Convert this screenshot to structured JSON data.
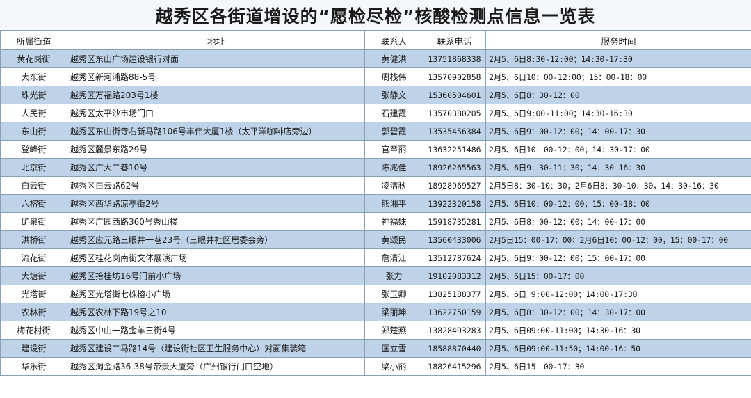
{
  "title": "越秀区各街道增设的“愿检尽检”核酸检测点信息一览表",
  "headers": {
    "street": "所属街道",
    "address": "地址",
    "contact": "联系人",
    "phone": "联系电话",
    "hours": "服务时间"
  },
  "rows": [
    {
      "street": "黄花岗街",
      "address": "越秀区东山广场建设银行对面",
      "contact": "黄健洪",
      "phone": "13751868338",
      "hours": "2月5、6日8:30-12:00；14:30-17:30"
    },
    {
      "street": "大东街",
      "address": "越秀区新河浦路88-5号",
      "contact": "周栈伟",
      "phone": "13570902858",
      "hours": "2月5、6日10：00-12:00；15：00-18：00"
    },
    {
      "street": "珠光街",
      "address": "越秀区万福路203号1楼",
      "contact": "张静文",
      "phone": "15360504601",
      "hours": "2月5、6日8：30-12：00"
    },
    {
      "street": "人民街",
      "address": "越秀区太平沙市场门口",
      "contact": "石建霞",
      "phone": "13570380205",
      "hours": "2月5、6日9:00-11:00；14:30-16:30"
    },
    {
      "street": "东山街",
      "address": "越秀区东山街寺右新马路106号丰伟大厦1楼（太平洋咖啡店旁边）",
      "contact": "郭碧霞",
      "phone": "13535456384",
      "hours": "2月5、6日9：00-12：00；14：00-17：30"
    },
    {
      "street": "登峰街",
      "address": "越秀区麓景东路29号",
      "contact": "官章丽",
      "phone": "13632251486",
      "hours": "2月5、6日10：00-12：00；14：30-17：00"
    },
    {
      "street": "北京街",
      "address": "越秀区广大二巷10号",
      "contact": "陈兆佳",
      "phone": "18926265563",
      "hours": "2月5、6日9：30-11：30；14：30—16：30"
    },
    {
      "street": "白云街",
      "address": "越秀区白云路62号",
      "contact": "凌洁秋",
      "phone": "18928969527",
      "hours": "2月5日8：30-10：30；2月6日8：30-10：30，14：30-16：30"
    },
    {
      "street": "六榕街",
      "address": "越秀区西华路凉亭街2号",
      "contact": "熊湘平",
      "phone": "13922320158",
      "hours": "2月5、6日10：00-12：00；15：00-18：00"
    },
    {
      "street": "矿泉街",
      "address": "越秀区广园西路360号秀山楼",
      "contact": "神福妹",
      "phone": "15918735281",
      "hours": "2月5、6日8：00-12：00；14：00-17：00"
    },
    {
      "street": "洪桥街",
      "address": "越秀区应元路三眼井一巷23号（三眼井社区居委会旁）",
      "contact": "黄颂民",
      "phone": "13560433006",
      "hours": "2月5日15：00-17：00；2月6日10：00-12：00，15：00-17：00"
    },
    {
      "street": "流花街",
      "address": "越秀区桂花岗南街文体展演广场",
      "contact": "詹清江",
      "phone": "13512787624",
      "hours": "2月5、6日9：00-12：00；15：00-17：00"
    },
    {
      "street": "大塘街",
      "address": "越秀区拾桂坊16号门前小广场",
      "contact": "张力",
      "phone": "19102083312",
      "hours": "2月5、6日15：00-17：00"
    },
    {
      "street": "光塔街",
      "address": "越秀区光塔街七株榕小广场",
      "contact": "张玉卿",
      "phone": "13825188377",
      "hours": "2月5、6日 9:00-12:00；14:00-17:30"
    },
    {
      "street": "农林街",
      "address": "越秀区农林下路19号之10",
      "contact": "梁丽坤",
      "phone": "13622750159",
      "hours": "2月5、6日8：30-12：00；14：30-17：00"
    },
    {
      "street": "梅花村街",
      "address": "越秀区中山一路金羊三街4号",
      "contact": "郑楚燕",
      "phone": "13828493283",
      "hours": "2月5、6日09:00-11:00；14:30-16：30"
    },
    {
      "street": "建设街",
      "address": "越秀区建设二马路14号（建设街社区卫生服务中心）对面集装箱",
      "contact": "匡立雪",
      "phone": "18588870440",
      "hours": "2月5、6日09:00-11:50；14:00-16：50"
    },
    {
      "street": "华乐街",
      "address": "越秀区淘金路36-38号帝景大厦旁（广州银行门口空地）",
      "contact": "梁小丽",
      "phone": "18826415296",
      "hours": "2月5、6日15：00-17：30"
    }
  ],
  "colors": {
    "row_shade": "#bed2e8",
    "border": "#8a9fb8"
  }
}
